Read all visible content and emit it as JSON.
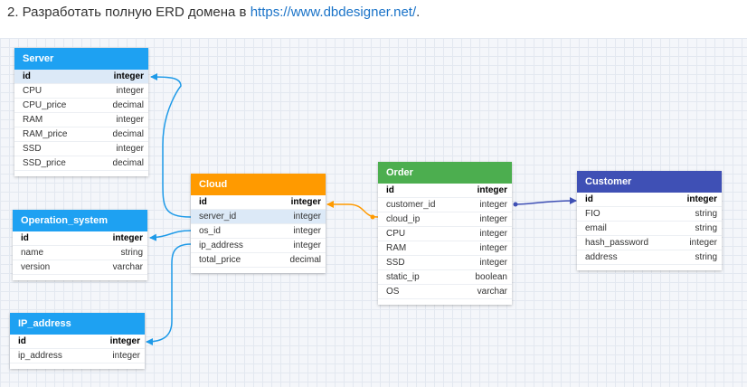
{
  "heading": {
    "prefix": "2. Разработать полную ERD домена в ",
    "link": "https://www.dbdesigner.net/",
    "suffix": "."
  },
  "colors": {
    "server": "#1ea1f2",
    "operation_system": "#1ea1f2",
    "ip_address": "#1ea1f2",
    "cloud": "#ff9a00",
    "order": "#4cae4f",
    "customer": "#3f50b5",
    "blue_link": "#1e9ae8",
    "orange_link": "#ff9a00",
    "indigo_link": "#3f50b5"
  },
  "tables": {
    "server": {
      "name": "Server",
      "rows": [
        {
          "field": "id",
          "type": "integer"
        },
        {
          "field": "CPU",
          "type": "integer"
        },
        {
          "field": "CPU_price",
          "type": "decimal"
        },
        {
          "field": "RAM",
          "type": "integer"
        },
        {
          "field": "RAM_price",
          "type": "decimal"
        },
        {
          "field": "SSD",
          "type": "integer"
        },
        {
          "field": "SSD_price",
          "type": "decimal"
        }
      ]
    },
    "operation_system": {
      "name": "Operation_system",
      "rows": [
        {
          "field": "id",
          "type": "integer"
        },
        {
          "field": "name",
          "type": "string"
        },
        {
          "field": "version",
          "type": "varchar"
        }
      ]
    },
    "ip_address": {
      "name": "IP_address",
      "rows": [
        {
          "field": "id",
          "type": "integer"
        },
        {
          "field": "ip_address",
          "type": "integer"
        }
      ]
    },
    "cloud": {
      "name": "Cloud",
      "rows": [
        {
          "field": "id",
          "type": "integer"
        },
        {
          "field": "server_id",
          "type": "integer"
        },
        {
          "field": "os_id",
          "type": "integer"
        },
        {
          "field": "ip_address",
          "type": "integer"
        },
        {
          "field": "total_price",
          "type": "decimal"
        }
      ]
    },
    "order": {
      "name": "Order",
      "rows": [
        {
          "field": "id",
          "type": "integer"
        },
        {
          "field": "customer_id",
          "type": "integer"
        },
        {
          "field": "cloud_ip",
          "type": "integer"
        },
        {
          "field": "CPU",
          "type": "integer"
        },
        {
          "field": "RAM",
          "type": "integer"
        },
        {
          "field": "SSD",
          "type": "integer"
        },
        {
          "field": "static_ip",
          "type": "boolean"
        },
        {
          "field": "OS",
          "type": "varchar"
        }
      ]
    },
    "customer": {
      "name": "Customer",
      "rows": [
        {
          "field": "id",
          "type": "integer"
        },
        {
          "field": "FIO",
          "type": "string"
        },
        {
          "field": "email",
          "type": "string"
        },
        {
          "field": "hash_password",
          "type": "integer"
        },
        {
          "field": "address",
          "type": "string"
        }
      ]
    }
  }
}
